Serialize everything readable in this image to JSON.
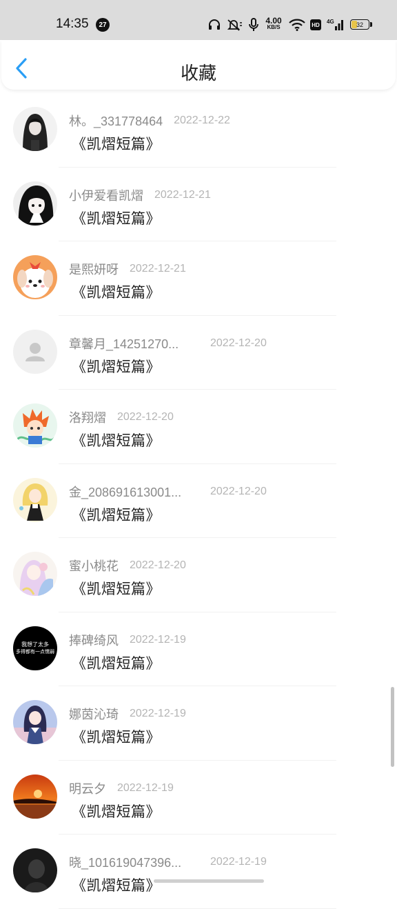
{
  "status_bar": {
    "time": "14:35",
    "notification_count": "27",
    "net_speed_value": "4.00",
    "net_speed_unit": "KB/S",
    "hd_label": "HD",
    "signal_label": "4G",
    "battery_level": "32"
  },
  "nav": {
    "title": "收藏"
  },
  "favorites": [
    {
      "name": "林。_331778464",
      "date": "2022-12-22",
      "content": "《凯熠短篇》",
      "avatar": "avatar-girl-bw"
    },
    {
      "name": "小伊爱看凯熠",
      "date": "2022-12-21",
      "content": "《凯熠短篇》",
      "avatar": "avatar-anime-bw"
    },
    {
      "name": "是熙妍呀",
      "date": "2022-12-21",
      "content": "《凯熠短篇》",
      "avatar": "avatar-dog-cartoon"
    },
    {
      "name": "章馨月_14251270...",
      "date": "2022-12-20",
      "content": "《凯熠短篇》",
      "avatar": "avatar-default-person"
    },
    {
      "name": "洛翔熠",
      "date": "2022-12-20",
      "content": "《凯熠短篇》",
      "avatar": "avatar-anime-boy"
    },
    {
      "name": "金_208691613001...",
      "date": "2022-12-20",
      "content": "《凯熠短篇》",
      "avatar": "avatar-anime-girl-yellow"
    },
    {
      "name": "蜜小桃花",
      "date": "2022-12-20",
      "content": "《凯熠短篇》",
      "avatar": "avatar-anime-pastel"
    },
    {
      "name": "捧碑绮风",
      "date": "2022-12-19",
      "content": "《凯熠短篇》",
      "avatar": "avatar-text-black",
      "avatar_text_1": "我想了太多",
      "avatar_text_2": "多得都有一点懦弱"
    },
    {
      "name": "娜茵沁琦",
      "date": "2022-12-19",
      "content": "《凯熠短篇》",
      "avatar": "avatar-anime-school"
    },
    {
      "name": "明云夕",
      "date": "2022-12-19",
      "content": "《凯熠短篇》",
      "avatar": "avatar-sunset"
    },
    {
      "name": "晓_101619047396...",
      "date": "2022-12-19",
      "content": "《凯熠短篇》",
      "avatar": "avatar-dark-photo"
    }
  ],
  "colors": {
    "accent": "#2a9ef5",
    "name_text": "#8a8a8a",
    "date_text": "#b4b4b4",
    "content_text": "#222222",
    "status_bar_bg": "#dcdcdc"
  }
}
